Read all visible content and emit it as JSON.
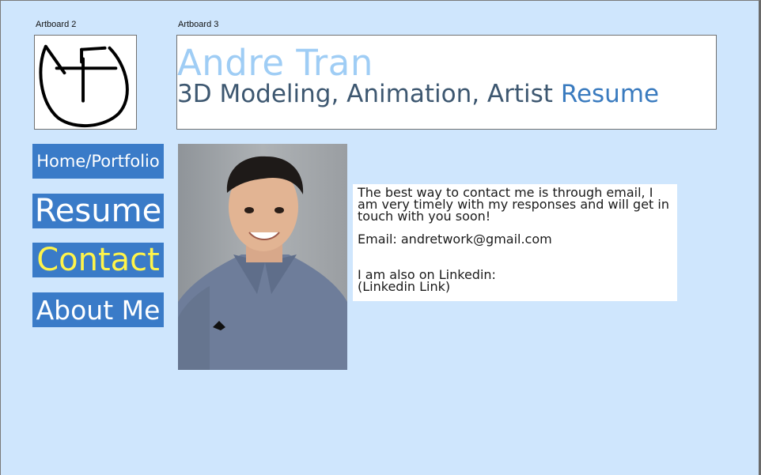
{
  "artboards": {
    "left_label": "Artboard 2",
    "right_label": "Artboard 3"
  },
  "header": {
    "name": "Andre Tran",
    "subtitle": "3D Modeling, Animation, Artist",
    "subtitle_accent": "Resume"
  },
  "nav": {
    "home": "Home/Portfolio",
    "resume": "Resume",
    "contact": "Contact",
    "about": "About Me"
  },
  "contact": {
    "intro": "The best way to contact me is through email, I am very timely with my responses and will get in touch with you soon!",
    "email_line": "Email: andretwork@gmail.com",
    "linkedin_line": "I am also on Linkedin:",
    "linkedin_link": "(Linkedin Link)"
  },
  "colors": {
    "background": "#cfe6fd",
    "nav_button": "#3a7bc8",
    "nav_active_text": "#fff44a",
    "name_color": "#9fcdf5",
    "subtitle_color": "#3d5770",
    "accent": "#3a7bbf"
  },
  "icons": {
    "logo": "at-monogram-logo",
    "photo": "portrait-photo"
  }
}
